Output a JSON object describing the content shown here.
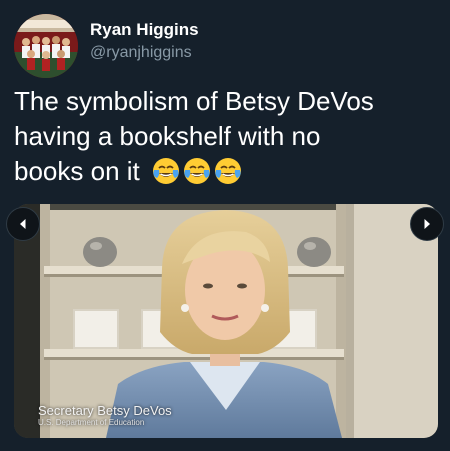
{
  "author": {
    "display_name": "Ryan Higgins",
    "handle": "@ryanjhiggins"
  },
  "tweet": {
    "line1": "The symbolism of Betsy DeVos",
    "line2": "having a bookshelf with no",
    "line3": "books on it",
    "emojis": [
      "face-with-tears-of-joy",
      "face-with-tears-of-joy",
      "face-with-tears-of-joy"
    ]
  },
  "media": {
    "caption_name": "Secretary Betsy DeVos",
    "caption_sub": "U.S. Department of Education",
    "nav_prev_icon": "chevron-left-icon",
    "nav_next_icon": "chevron-right-icon"
  },
  "colors": {
    "background": "#15202b",
    "text": "#ffffff",
    "secondary_text": "#8899a6"
  }
}
